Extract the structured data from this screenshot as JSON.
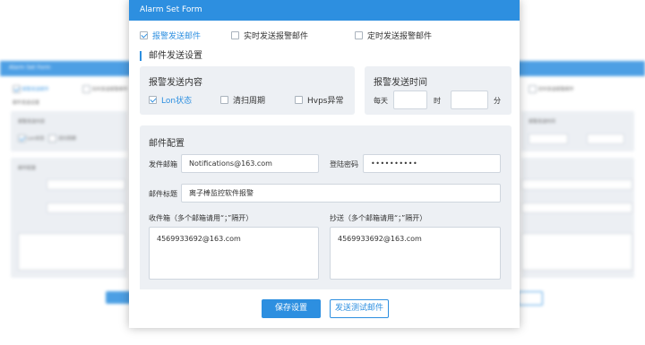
{
  "modal": {
    "title": "Alarm Set Form",
    "send_options": [
      {
        "label": "报警发送邮件",
        "checked": true
      },
      {
        "label": "实时发送报警邮件",
        "checked": false
      },
      {
        "label": "定时发送报警邮件",
        "checked": false
      }
    ],
    "section_title": "邮件发送设置",
    "content_panel": {
      "title": "报警发送内容",
      "options": [
        {
          "label": "Lon状态",
          "checked": true
        },
        {
          "label": "清扫周期",
          "checked": false
        },
        {
          "label": "Hvps异常",
          "checked": false
        }
      ]
    },
    "time_panel": {
      "title": "报警发送时间",
      "every_day_label": "每天",
      "hour_unit": "时",
      "minute_unit": "分",
      "hour_value": "",
      "minute_value": ""
    },
    "mail_config": {
      "title": "邮件配置",
      "sender_label": "发件邮箱",
      "sender_value": "Notifications@163.com",
      "password_label": "登陆密码",
      "password_value": "••••••••••",
      "subject_label": "邮件标题",
      "subject_value": "离子棒监控软件报警",
      "recipients_label": "收件箱（多个邮箱请用“；”隔开）",
      "recipients_value": "4569933692@163.com",
      "cc_label": "抄送（多个邮箱请用“；”隔开）",
      "cc_value": "4569933692@163.com"
    },
    "buttons": {
      "save": "保存设置",
      "send_test": "发送测试邮件"
    }
  },
  "background": {
    "title": "Alarm Set Form",
    "section_title": "邮件发送设置",
    "mail_config_title": "邮件配置",
    "sender_value": "Notifications@163.com",
    "recipients_value": "4569933692@163.com"
  }
}
